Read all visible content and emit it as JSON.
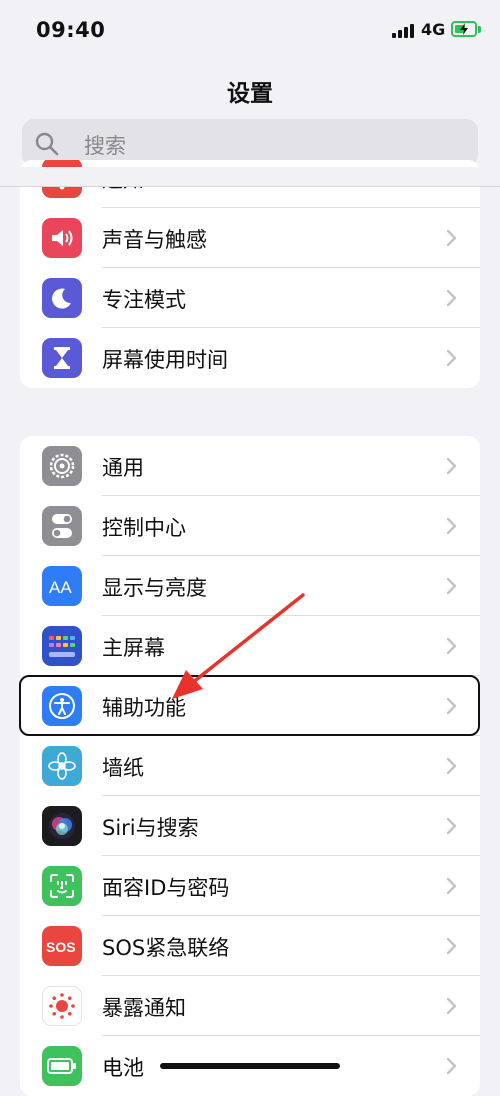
{
  "status": {
    "time": "09:40",
    "network": "4G"
  },
  "nav": {
    "title": "设置"
  },
  "search": {
    "placeholder": "搜索"
  },
  "colors": {
    "arrow": "#e8322b",
    "highlight_border": "#111111",
    "battery": "#2ec25a"
  },
  "group1": {
    "items": [
      {
        "label": "通知",
        "icon": "bell-icon",
        "color": "#e9463f"
      },
      {
        "label": "声音与触感",
        "icon": "speaker-icon",
        "color": "#e9455b"
      },
      {
        "label": "专注模式",
        "icon": "moon-icon",
        "color": "#5a5ad6"
      },
      {
        "label": "屏幕使用时间",
        "icon": "hourglass-icon",
        "color": "#5a5ad6"
      }
    ]
  },
  "group2": {
    "items": [
      {
        "label": "通用",
        "icon": "gear-icon",
        "color": "#8e8e93"
      },
      {
        "label": "控制中心",
        "icon": "switches-icon",
        "color": "#8e8e93"
      },
      {
        "label": "显示与亮度",
        "icon": "text-size-icon",
        "color": "#2f7cf6"
      },
      {
        "label": "主屏幕",
        "icon": "app-grid-icon",
        "color": "#2f52c8"
      },
      {
        "label": "辅助功能",
        "icon": "accessibility-icon",
        "color": "#2f7cf6"
      },
      {
        "label": "墙纸",
        "icon": "flower-icon",
        "color": "#3ea9d6"
      },
      {
        "label": "Siri与搜索",
        "icon": "siri-icon",
        "color": "#1c1c1e"
      },
      {
        "label": "面容ID与密码",
        "icon": "face-id-icon",
        "color": "#3fc25e"
      },
      {
        "label": "SOS紧急联络",
        "icon": "sos-icon",
        "color": "#e9463f"
      },
      {
        "label": "暴露通知",
        "icon": "exposure-icon",
        "color": "#ffffff"
      },
      {
        "label": "电池",
        "icon": "battery-icon",
        "color": "#3fc25e"
      }
    ]
  }
}
